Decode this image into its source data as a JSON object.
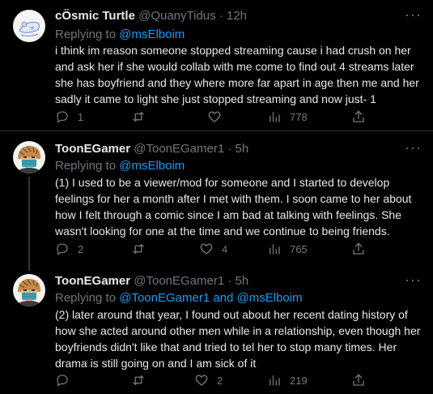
{
  "tweets": [
    {
      "name": "cÖsmic Turtle",
      "handle": "@QuanyTidus",
      "time": "12h",
      "replying_label": "Replying to ",
      "replying_mentions": "@msElboim",
      "lines": [
        "i think im reason someone stopped streaming cause i had crush on her",
        "and ask her if she would collab with me come to find out 4 streams later",
        "she has boyfriend and they where more far apart in age then me and her",
        "sadly it came to light she just stopped streaming and now just- 1"
      ],
      "replies": "1",
      "retweets": "",
      "likes": "",
      "views": "778"
    },
    {
      "name": "ToonEGamer",
      "handle": "@ToonEGamer1",
      "time": "5h",
      "replying_label": "Replying to ",
      "replying_mentions": "@msElboim",
      "lines": [
        "(1) I used to be a viewer/mod for someone and I started to develop",
        "feelings for her a month after I met with them. I soon came to her about",
        "how I felt through a comic since I am bad at talking with feelings. She",
        "wasn't looking for one at the time and we continue to being friends."
      ],
      "replies": "2",
      "retweets": "",
      "likes": "4",
      "views": "765"
    },
    {
      "name": "ToonEGamer",
      "handle": "@ToonEGamer1",
      "time": "5h",
      "replying_label": "Replying to ",
      "replying_mentions": "@ToonEGamer1 and @msElboim",
      "lines": [
        "(2) later around that year, I found out about her recent dating history of",
        "how she acted around other men while in a relationship, even though her",
        "boyfriends didn't like that and tried to tel her to stop many times. Her",
        "drama is still going on and I am sick of it"
      ],
      "replies": "",
      "retweets": "",
      "likes": "2",
      "views": "219"
    }
  ],
  "separator": "·",
  "more_glyph": "···",
  "colors": {
    "background": "#000000",
    "text": "#e7e9ea",
    "muted": "#71767b",
    "link": "#1d9bf0",
    "divider": "#2f3336"
  }
}
